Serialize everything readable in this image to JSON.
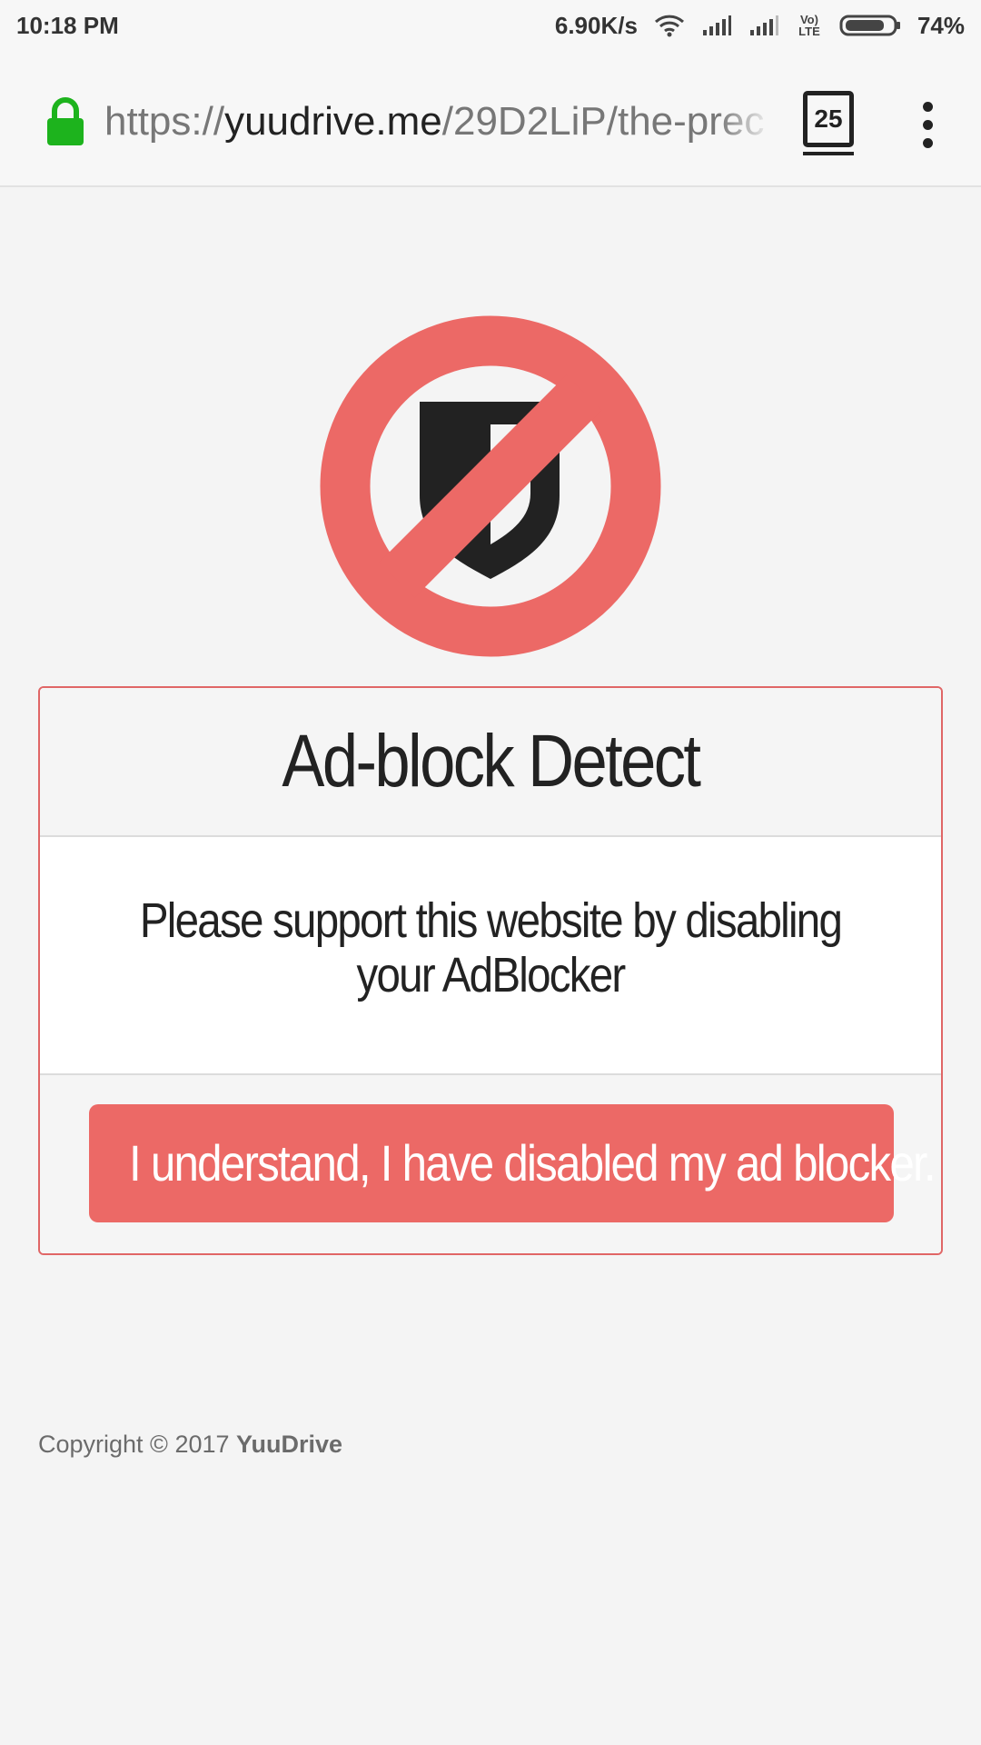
{
  "status_bar": {
    "time": "10:18 PM",
    "net_speed": "6.90K/s",
    "network_label": "Vo) LTE",
    "battery": "74%",
    "icons": [
      "wifi-icon",
      "signal-icon",
      "signal-icon",
      "volte-icon",
      "battery-icon"
    ]
  },
  "browser": {
    "url_scheme": "https://",
    "url_host": "yuudrive.me",
    "url_path": "/29D2LiP/the-prec",
    "tab_count": "25",
    "icons": [
      "lock-icon",
      "tabs-icon",
      "more-options-icon"
    ],
    "lock_color": "#1db31d"
  },
  "modal": {
    "title": "Ad-block Detect",
    "message": "Please support this website by disabling your AdBlocker",
    "button_label": "I understand, I have disabled my ad blocker.",
    "accent_color": "#ec6966",
    "icon": "adblock-prohibited-icon"
  },
  "footer": {
    "copyright_prefix": "Copyright © 2017",
    "brand": "YuuDrive"
  }
}
